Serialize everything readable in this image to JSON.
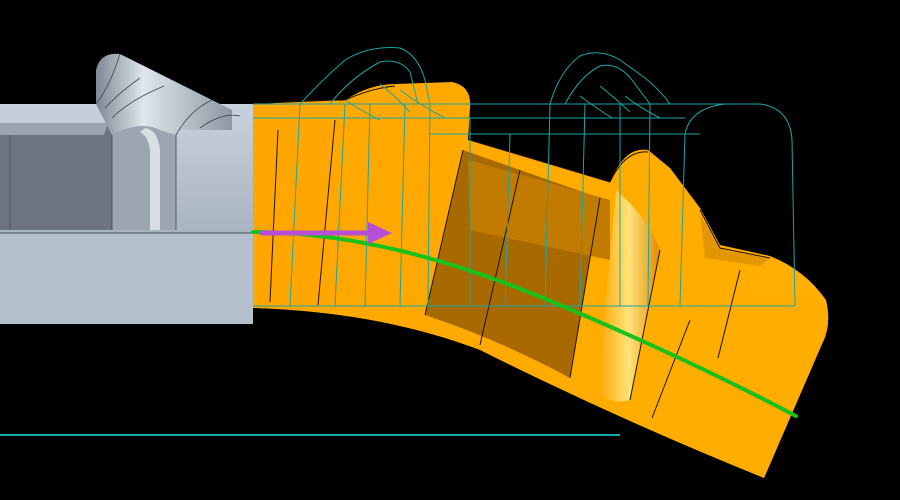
{
  "viewport": {
    "background": "#000000"
  },
  "model": {
    "base_part_color": "#b7c3cf",
    "base_part_shadow": "#6f7883",
    "swept_body_color": "#ffaa00",
    "swept_body_shadow": "#a96a00",
    "wireframe_color": "#1aa6a6",
    "sweep_path_color": "#18c21a",
    "direction_arrow_color": "#b74fd6",
    "reference_line_color": "#18a9a9"
  },
  "icons": {
    "direction_arrow": "arrow-right-icon"
  }
}
